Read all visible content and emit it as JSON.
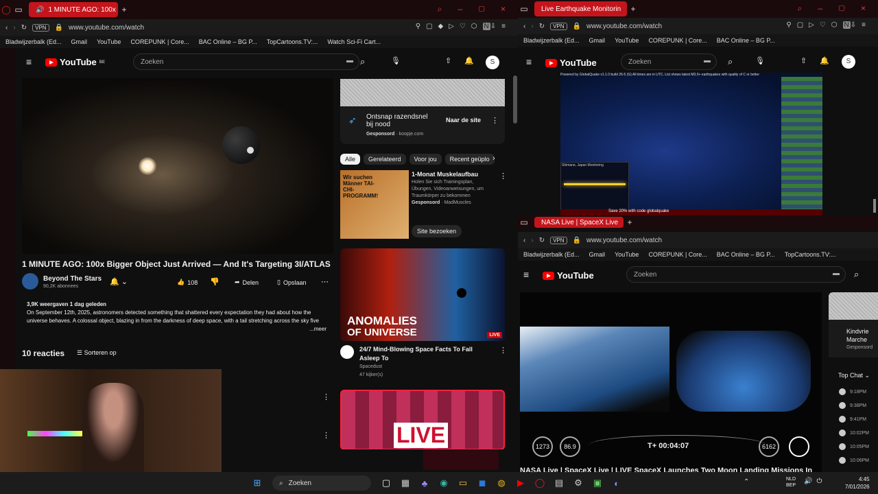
{
  "left_window": {
    "tab_title": "1 MINUTE AGO: 100x Bi",
    "url": "www.youtube.com/watch",
    "vpn_label": "VPN",
    "bookmarks": [
      "Bladwijzerbalk (Ed...",
      "Gmail",
      "YouTube",
      "COREPUNK | Core...",
      "BAC Online – BG P...",
      "TopCartoons.TV:...",
      "Watch Sci-Fi Cart..."
    ],
    "yt": {
      "logo": "YouTube",
      "region": "BE",
      "search_placeholder": "Zoeken",
      "avatar": "S"
    },
    "video": {
      "title": "1 MINUTE AGO: 100x Bigger Object Just Arrived — And It's Targeting 3I/ATLAS",
      "channel": "Beyond The Stars",
      "subs": "90,2K abonnees",
      "likes": "108",
      "share": "Delen",
      "save": "Opslaan",
      "meta": "3,9K weergaven  1 dag geleden",
      "description": "On September 12th, 2025, astronomers detected something that shattered every expectation they had about how the universe behaves. A colossal object, blazing in from the darkness of deep space, with a tail stretching across the sky five times the width of a full moon, so enormous that even amateur astronomers with backyard telescopes co",
      "more": "...meer",
      "comments": "10 reacties",
      "sort": "Sorteren op"
    },
    "ad": {
      "title": "Ontsnap razendsnel bij nood",
      "sponsored": "Gesponsord",
      "domain": "koopje.com",
      "cta": "Naar de site"
    },
    "chips": [
      "Alle",
      "Gerelateerd",
      "Voor jou",
      "Recent geüplo"
    ],
    "rec1": {
      "title": "1-Monat Muskelaufbau",
      "desc": "Holen Sie sich Trainingsplan, Übungen, Videoanweisungen, um Traumkörper zu bekommen",
      "sponsored": "Gesponsord",
      "advertiser": "MadMuscles",
      "cta": "Site bezoeken",
      "thumb_text": "Wir suchen Männer TAI-CHI-PROGRAMM!"
    },
    "rec2": {
      "title": "24/7 Mind-Blowing Space Facts To Fall Asleep To",
      "channel": "Spacedust",
      "viewers": "47 kijker(s)",
      "thumb_line1": "ANOMALIES",
      "thumb_line2": "OF UNIVERSE",
      "live": "LIVE"
    },
    "rec3": {
      "thumb_text": "LIVE"
    }
  },
  "right_top": {
    "tab_title": "Live Earthquake Monitorin",
    "url": "www.youtube.com/watch",
    "bookmarks": [
      "Bladwijzerbalk (Ed...",
      "Gmail",
      "YouTube",
      "COREPUNK | Core...",
      "BAC Online – BG P..."
    ],
    "search_placeholder": "Zoeken",
    "avatar": "S",
    "map_header": "Powered by GlobalQuake v1.1.0 build 26-5 (G)    All times are in UTC. List shows latest M3.0+ earthquakes with quality of C or better",
    "seismo_label": "Shimane, Japan Monitoring",
    "promo": "Save 20% with code globalquake"
  },
  "right_bottom": {
    "tab_title": "NASA Live | SpaceX Live",
    "url": "www.youtube.com/watch",
    "bookmarks": [
      "Bladwijzerbalk (Ed...",
      "Gmail",
      "YouTube",
      "COREPUNK | Core...",
      "BAC Online – BG P...",
      "TopCartoons.TV:..."
    ],
    "search_placeholder": "Zoeken",
    "telemetry": {
      "speed1": "1273",
      "alt1": "86.9",
      "timer": "T+ 00:04:07",
      "speed2": "6162"
    },
    "title": "NASA Live | SpaceX Live | LIVE SpaceX Launches Two Moon Landing Missions In",
    "side_text1": "Kindvrie",
    "side_text2": "Marche",
    "side_spons": "Gesponsord",
    "chat_label": "Top Chat",
    "chat_times": [
      "9:18PM",
      "9:38PM",
      "9:41PM",
      "10:02PM",
      "10:05PM",
      "10:06PM",
      "10:06PM"
    ]
  },
  "taskbar": {
    "search": "Zoeken",
    "lang1": "NLD",
    "lang2": "BEP",
    "time": "4:45",
    "date": "7/01/2026"
  },
  "colors": {
    "accent": "#ff0000",
    "bg": "#0f0f0f",
    "tab": "#c4151c"
  }
}
